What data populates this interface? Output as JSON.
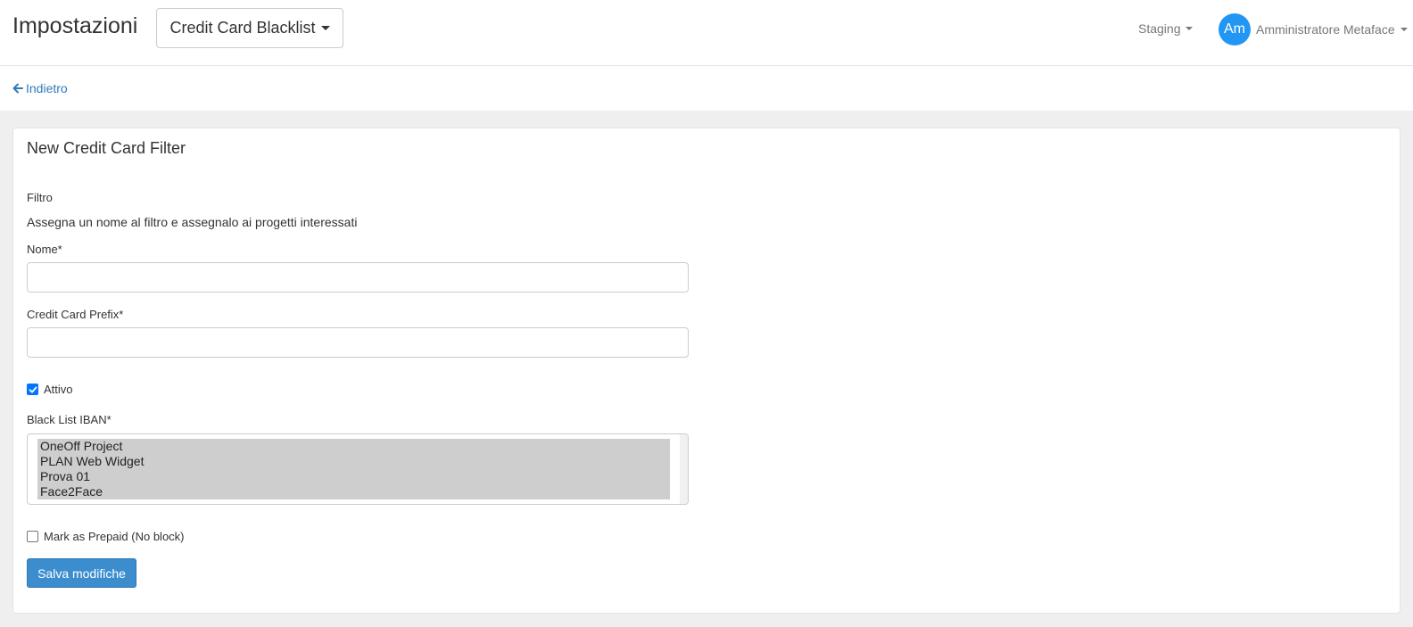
{
  "header": {
    "title": "Impostazioni",
    "section_dropdown": "Credit Card Blacklist",
    "environment": "Staging",
    "user": {
      "initials": "Am",
      "name": "Amministratore Metaface"
    },
    "colors": {
      "avatar": "#2196f3"
    }
  },
  "nav": {
    "back_label": "Indietro"
  },
  "form": {
    "title": "New Credit Card Filter",
    "section_label": "Filtro",
    "section_description": "Assegna un nome al filtro e assegnalo ai progetti interessati",
    "name": {
      "label": "Nome*",
      "value": ""
    },
    "prefix": {
      "label": "Credit Card Prefix*",
      "value": ""
    },
    "active": {
      "label": "Attivo",
      "checked": true
    },
    "blacklist": {
      "label": "Black List IBAN*",
      "options": [
        "OneOff Project",
        "PLAN Web Widget",
        "Prova 01",
        "Face2Face"
      ],
      "selected": [
        "OneOff Project",
        "PLAN Web Widget",
        "Prova 01",
        "Face2Face"
      ]
    },
    "prepaid": {
      "label": "Mark as Prepaid (No block)",
      "checked": false
    },
    "save_label": "Salva modifiche",
    "colors": {
      "primary": "#3c8dce",
      "link": "#337ab7",
      "checkbox": "#0075ff"
    }
  }
}
